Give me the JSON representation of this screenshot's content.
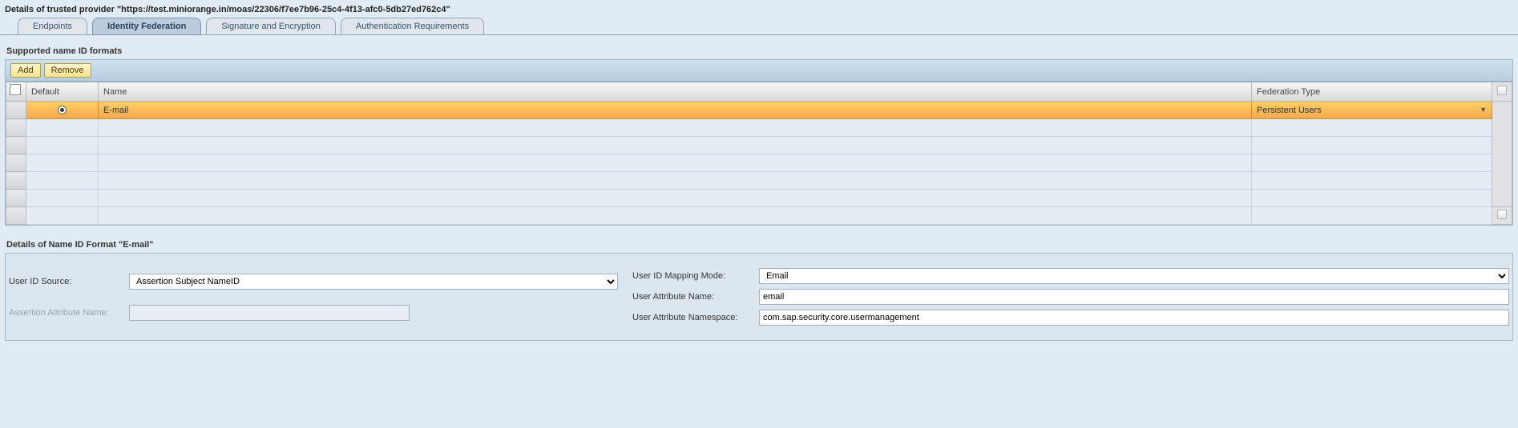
{
  "header": {
    "title": "Details of trusted provider \"https://test.miniorange.in/moas/22306/f7ee7b96-25c4-4f13-afc0-5db27ed762c4\""
  },
  "tabs": [
    {
      "label": "Endpoints"
    },
    {
      "label": "Identity Federation"
    },
    {
      "label": "Signature and Encryption"
    },
    {
      "label": "Authentication Requirements"
    }
  ],
  "section1": {
    "title": "Supported name ID formats"
  },
  "toolbar": {
    "add": "Add",
    "remove": "Remove"
  },
  "table": {
    "cols": {
      "default": "Default",
      "name": "Name",
      "federation": "Federation Type"
    },
    "rows": [
      {
        "default": true,
        "name": "E-mail",
        "federation": "Persistent Users"
      }
    ]
  },
  "section2": {
    "title": "Details of Name ID Format \"E-mail\""
  },
  "form": {
    "left": {
      "user_id_source": {
        "label": "User ID Source:",
        "value": "Assertion Subject NameID"
      },
      "assertion_attr": {
        "label": "Assertion Attribute Name:",
        "value": ""
      }
    },
    "right": {
      "mapping_mode": {
        "label": "User ID Mapping Mode:",
        "value": "Email"
      },
      "user_attr_name": {
        "label": "User Attribute Name:",
        "value": "email"
      },
      "user_attr_ns": {
        "label": "User Attribute Namespace:",
        "value": "com.sap.security.core.usermanagement"
      }
    }
  }
}
